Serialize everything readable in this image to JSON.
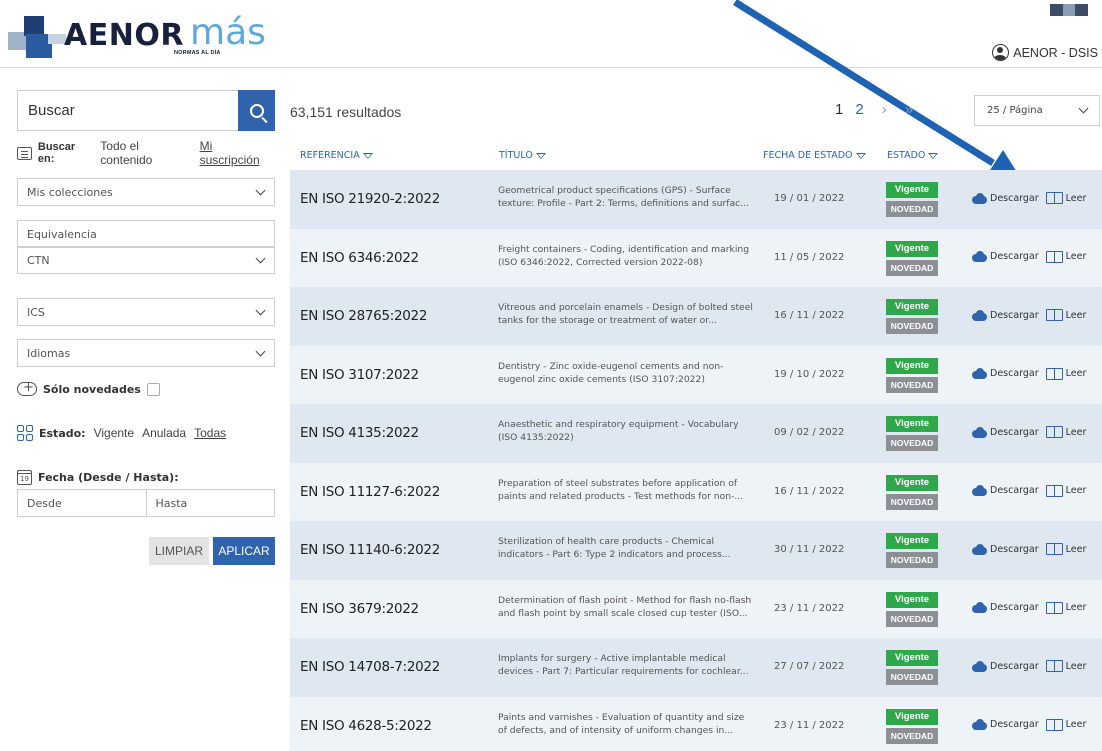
{
  "brand": {
    "name": "AENOR",
    "suffix": "más",
    "tagline": "NORMAS AL DÍA"
  },
  "user": {
    "label": "AENOR - DSIS"
  },
  "search": {
    "placeholder": "Buscar"
  },
  "search_in": {
    "label": "Buscar en:",
    "options": [
      "Todo el contenido",
      "Mi suscripción"
    ],
    "active": "Mi suscripción"
  },
  "filters": {
    "colecciones": "Mis colecciones",
    "equivalencia": "Equivalencia",
    "ctn": "CTN",
    "ics": "ICS",
    "idiomas": "Idiomas",
    "novedades_label": "Sólo novedades",
    "estado_label": "Estado:",
    "estado_options": [
      "Vigente",
      "Anulada",
      "Todas"
    ],
    "estado_active": "Todas",
    "fecha_label": "Fecha (Desde / Hasta):",
    "calendar_day": "19",
    "desde": "Desde",
    "hasta": "Hasta",
    "limpiar": "LIMPIAR",
    "aplicar": "APLICAR"
  },
  "results": {
    "count": "63,151 resultados",
    "pages": [
      "1",
      "2"
    ],
    "next": "›",
    "last": "»",
    "per_page": "25 / Página"
  },
  "columns": {
    "ref": "REFERENCIA",
    "title": "TÍTULO",
    "date": "FECHA DE ESTADO",
    "status": "ESTADO"
  },
  "actions": {
    "download": "Descargar",
    "read": "Leer"
  },
  "badges": {
    "vigente": "Vigente",
    "novedad": "NOVEDAD"
  },
  "rows": [
    {
      "ref": "EN ISO 21920-2:2022",
      "title1": "Geometrical product specifications (GPS) - Surface",
      "title2": "texture: Profile - Part 2: Terms, definitions and surfac...",
      "date": "19 / 01 / 2022"
    },
    {
      "ref": "EN ISO 6346:2022",
      "title1": "Freight containers - Coding, identification and marking",
      "title2": "(ISO 6346:2022, Corrected version 2022-08)",
      "date": "11 / 05 / 2022"
    },
    {
      "ref": "EN ISO 28765:2022",
      "title1": "Vitreous and porcelain enamels - Design of bolted steel",
      "title2": "tanks for the storage or treatment of water or...",
      "date": "16 / 11 / 2022"
    },
    {
      "ref": "EN ISO 3107:2022",
      "title1": "Dentistry - Zinc oxide-eugenol cements and non-",
      "title2": "eugenol zinc oxide cements (ISO 3107:2022)",
      "date": "19 / 10 / 2022"
    },
    {
      "ref": "EN ISO 4135:2022",
      "title1": "Anaesthetic and respiratory equipment - Vocabulary",
      "title2": "(ISO 4135:2022)",
      "date": "09 / 02 / 2022"
    },
    {
      "ref": "EN ISO 11127-6:2022",
      "title1": "Preparation of steel substrates before application of",
      "title2": "paints and related products - Test methods for non-...",
      "date": "16 / 11 / 2022"
    },
    {
      "ref": "EN ISO 11140-6:2022",
      "title1": "Sterilization of health care products - Chemical",
      "title2": "indicators - Part 6: Type 2 indicators and process...",
      "date": "30 / 11 / 2022"
    },
    {
      "ref": "EN ISO 3679:2022",
      "title1": "Determination of flash point - Method for flash no-flash",
      "title2": "and flash point by small scale closed cup tester (ISO...",
      "date": "23 / 11 / 2022"
    },
    {
      "ref": "EN ISO 14708-7:2022",
      "title1": "Implants for surgery - Active implantable medical",
      "title2": "devices - Part 7: Particular requirements for cochlear...",
      "date": "27 / 07 / 2022"
    },
    {
      "ref": "EN ISO 4628-5:2022",
      "title1": "Paints and varnishes - Evaluation of quantity and size",
      "title2": "of defects, and of intensity of uniform changes in...",
      "date": "23 / 11 / 2022"
    }
  ],
  "colors": {
    "primary": "#2f64ad",
    "vigente": "#2ea84a",
    "novedad": "#8c9096",
    "row_a": "#dfe7f1",
    "row_b": "#eef3f8",
    "arrow": "#1e63b3"
  }
}
